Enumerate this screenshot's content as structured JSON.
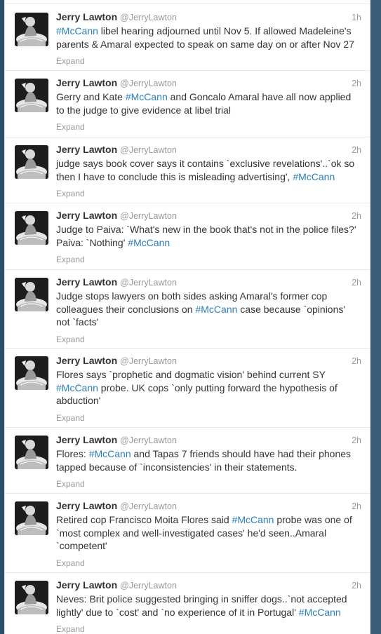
{
  "colors": {
    "hashtag": "#2a7fb8",
    "name": "#333333",
    "meta": "#999999",
    "background": "#2f4f66"
  },
  "tweets": [
    {
      "name": "Jerry Lawton",
      "handle": "@JerryLawton",
      "time": "1h",
      "expand": "Expand",
      "parts": [
        {
          "t": "#McCann",
          "tag": true
        },
        {
          "t": " libel hearing adjourned until Nov 5. If allowed Madeleine's parents & Amaral expected to speak on same day on or after Nov 27"
        }
      ]
    },
    {
      "name": "Jerry Lawton",
      "handle": "@JerryLawton",
      "time": "2h",
      "expand": "Expand",
      "parts": [
        {
          "t": "Gerry and Kate "
        },
        {
          "t": "#McCann",
          "tag": true
        },
        {
          "t": " and Goncalo Amaral have all now applied to the judge to give evidence at libel trial"
        }
      ]
    },
    {
      "name": "Jerry Lawton",
      "handle": "@JerryLawton",
      "time": "2h",
      "expand": "Expand",
      "parts": [
        {
          "t": "judge says book cover says it contains `exclusive revelations'..`ok so then I have to conclude this is misleading advertising', "
        },
        {
          "t": "#McCann",
          "tag": true
        }
      ]
    },
    {
      "name": "Jerry Lawton",
      "handle": "@JerryLawton",
      "time": "2h",
      "expand": "Expand",
      "parts": [
        {
          "t": "Judge to Paiva: `What's new in the book that's not in the police files?' Paiva: `Nothing' "
        },
        {
          "t": "#McCann",
          "tag": true
        }
      ]
    },
    {
      "name": "Jerry Lawton",
      "handle": "@JerryLawton",
      "time": "2h",
      "expand": "Expand",
      "parts": [
        {
          "t": "Judge stops lawyers on both sides asking Amaral's former cop colleagues their conclusions on "
        },
        {
          "t": "#McCann",
          "tag": true
        },
        {
          "t": " case because `opinions' not `facts'"
        }
      ]
    },
    {
      "name": "Jerry Lawton",
      "handle": "@JerryLawton",
      "time": "2h",
      "expand": "Expand",
      "parts": [
        {
          "t": "Flores says `prophetic and dogmatic vision' behind current SY "
        },
        {
          "t": "#McCann",
          "tag": true
        },
        {
          "t": " probe. UK cops `only putting forward the hypothesis of abduction'"
        }
      ]
    },
    {
      "name": "Jerry Lawton",
      "handle": "@JerryLawton",
      "time": "2h",
      "expand": "Expand",
      "parts": [
        {
          "t": "Flores: "
        },
        {
          "t": "#McCann",
          "tag": true
        },
        {
          "t": " and Tapas 7 friends should have had their phones tapped because of `inconsistencies' in their statements."
        }
      ]
    },
    {
      "name": "Jerry Lawton",
      "handle": "@JerryLawton",
      "time": "2h",
      "expand": "Expand",
      "parts": [
        {
          "t": "Retired cop Francisco Moita Flores said "
        },
        {
          "t": "#McCann",
          "tag": true
        },
        {
          "t": " probe was one of  `most complex and well-investigated cases' he'd seen..Amaral `competent'"
        }
      ]
    },
    {
      "name": "Jerry Lawton",
      "handle": "@JerryLawton",
      "time": "2h",
      "expand": "Expand",
      "parts": [
        {
          "t": "Neves: Brit police suggested bringing in sniffer dogs..`not accepted lightly' due to `cost' and `no experience of it in Portugal' "
        },
        {
          "t": "#McCann",
          "tag": true
        }
      ]
    }
  ]
}
